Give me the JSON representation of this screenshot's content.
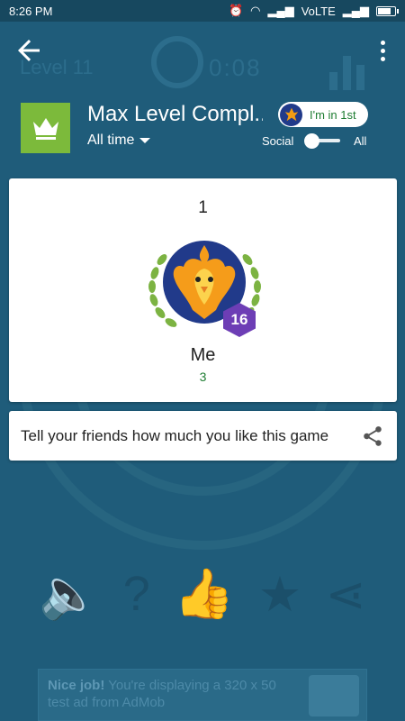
{
  "status_bar": {
    "time": "8:26 PM",
    "network": "VoLTE"
  },
  "background": {
    "level_text": "Level 11",
    "timer_text": "0:08",
    "ad_headline": "Nice job!",
    "ad_body": " You're displaying a 320 x 50 test ad from AdMob"
  },
  "header": {
    "title": "Max Level Compl...",
    "time_filter": "All time",
    "rank_chip": "I'm in 1st",
    "social_label": "Social",
    "all_label": "All",
    "toggle_state": "social"
  },
  "leaderboard": {
    "rank": "1",
    "player_name": "Me",
    "player_score": "3",
    "level": "16"
  },
  "share": {
    "text": "Tell your friends how much you like this game"
  },
  "colors": {
    "overlay": "#1f5c7a",
    "status_bar": "#17485f",
    "game_icon": "#7cba3b",
    "score_green": "#1e7d32",
    "level_badge": "#6d3eb5"
  },
  "icons": [
    "back-arrow-icon",
    "overflow-menu-icon",
    "crown-icon",
    "phoenix-avatar-icon",
    "share-icon"
  ]
}
